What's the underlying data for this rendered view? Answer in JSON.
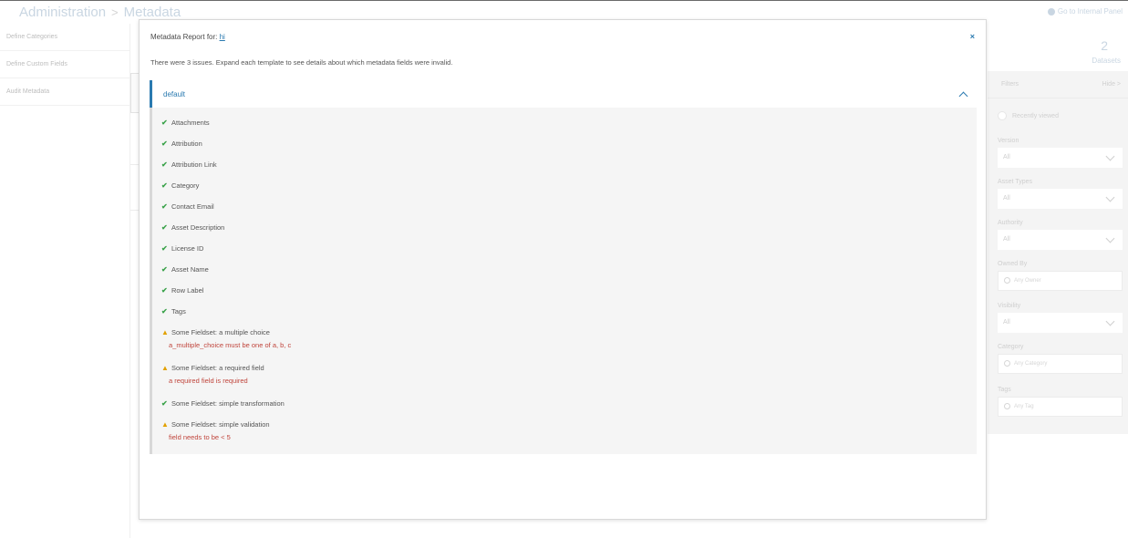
{
  "header": {
    "breadcrumb_root": "Administration",
    "breadcrumb_sep": ">",
    "breadcrumb_current": "Metadata",
    "internal_panel_link": "Go to Internal Panel"
  },
  "sidebar": {
    "items": [
      {
        "label": "Define Categories"
      },
      {
        "label": "Define Custom Fields"
      },
      {
        "label": "Audit Metadata"
      }
    ]
  },
  "right_panel": {
    "count": "2",
    "count_label": "Datasets",
    "filters_title": "Filters",
    "hide_label": "Hide >",
    "recently_viewed": "Recently viewed",
    "version_label": "Version",
    "version_value": "All",
    "asset_types_label": "Asset Types",
    "asset_types_value": "All",
    "authority_label": "Authority",
    "authority_value": "All",
    "owned_by_label": "Owned By",
    "owned_by_placeholder": "Any Owner",
    "visibility_label": "Visibility",
    "visibility_value": "All",
    "category_label": "Category",
    "category_placeholder": "Any Category",
    "tags_label": "Tags",
    "tags_placeholder": "Any Tag"
  },
  "modal": {
    "title_prefix": "Metadata Report for: ",
    "title_link": "hi",
    "close_glyph": "×",
    "summary": "There were 3 issues. Expand each template to see details about which metadata fields were invalid.",
    "template": {
      "name": "default",
      "fields": [
        {
          "status": "ok",
          "label": "Attachments"
        },
        {
          "status": "ok",
          "label": "Attribution"
        },
        {
          "status": "ok",
          "label": "Attribution Link"
        },
        {
          "status": "ok",
          "label": "Category"
        },
        {
          "status": "ok",
          "label": "Contact Email"
        },
        {
          "status": "ok",
          "label": "Asset Description"
        },
        {
          "status": "ok",
          "label": "License ID"
        },
        {
          "status": "ok",
          "label": "Asset Name"
        },
        {
          "status": "ok",
          "label": "Row Label"
        },
        {
          "status": "ok",
          "label": "Tags"
        },
        {
          "status": "warn",
          "label": "Some Fieldset: a multiple choice",
          "error": "a_multiple_choice must be one of a, b, c"
        },
        {
          "status": "warn",
          "label": "Some Fieldset: a required field",
          "error": "a required field is required"
        },
        {
          "status": "ok",
          "label": "Some Fieldset: simple transformation"
        },
        {
          "status": "warn",
          "label": "Some Fieldset: simple validation",
          "error": "field needs to be < 5"
        }
      ]
    }
  },
  "icons": {
    "ok": "check-icon",
    "warn": "warning-icon",
    "ok_color": "#3aa24a",
    "warn_color": "#e2a100",
    "error_color": "#c0453c",
    "accent": "#2a7ab0"
  }
}
